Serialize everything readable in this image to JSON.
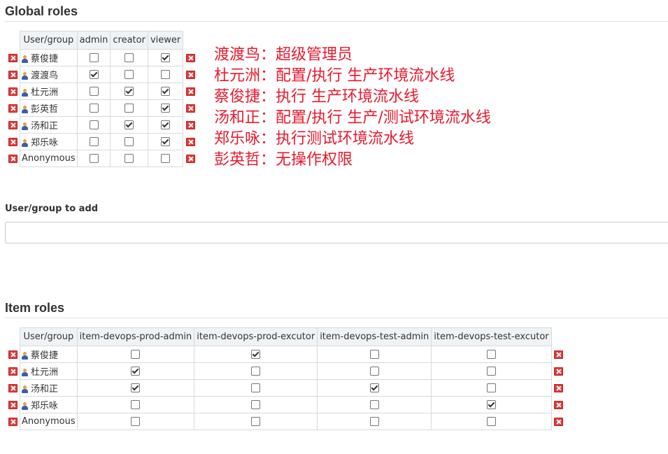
{
  "global": {
    "title": "Global roles",
    "header": "User/group",
    "columns": [
      "admin",
      "creator",
      "viewer"
    ],
    "rows": [
      {
        "name": "蔡俊捷",
        "user": true,
        "checks": [
          false,
          false,
          true
        ]
      },
      {
        "name": "渡渡鸟",
        "user": true,
        "checks": [
          true,
          false,
          false
        ]
      },
      {
        "name": "杜元洲",
        "user": true,
        "checks": [
          false,
          true,
          true
        ]
      },
      {
        "name": "彭英哲",
        "user": true,
        "checks": [
          false,
          false,
          true
        ]
      },
      {
        "name": "汤和正",
        "user": true,
        "checks": [
          false,
          true,
          true
        ]
      },
      {
        "name": "郑乐咏",
        "user": true,
        "checks": [
          false,
          false,
          true
        ]
      },
      {
        "name": "Anonymous",
        "user": false,
        "checks": [
          false,
          false,
          false
        ]
      }
    ]
  },
  "notes": [
    "渡渡鸟：超级管理员",
    "杜元洲：配置/执行 生产环境流水线",
    "蔡俊捷：执行 生产环境流水线",
    "汤和正：配置/执行 生产/测试环境流水线",
    "郑乐咏：执行测试环境流水线",
    "彭英哲：无操作权限"
  ],
  "add": {
    "label": "User/group to add",
    "value": ""
  },
  "item": {
    "title": "Item roles",
    "header": "User/group",
    "columns": [
      "item-devops-prod-admin",
      "item-devops-prod-excutor",
      "item-devops-test-admin",
      "item-devops-test-excutor"
    ],
    "rows": [
      {
        "name": "蔡俊捷",
        "user": true,
        "checks": [
          false,
          true,
          false,
          false
        ]
      },
      {
        "name": "杜元洲",
        "user": true,
        "checks": [
          true,
          false,
          false,
          false
        ]
      },
      {
        "name": "汤和正",
        "user": true,
        "checks": [
          true,
          false,
          true,
          false
        ]
      },
      {
        "name": "郑乐咏",
        "user": true,
        "checks": [
          false,
          false,
          false,
          true
        ]
      },
      {
        "name": "Anonymous",
        "user": false,
        "checks": [
          false,
          false,
          false,
          false
        ]
      }
    ]
  },
  "colors": {
    "note": "#e8192c",
    "delete": "#e23b3b",
    "header_bg": "#f0f3f5"
  }
}
